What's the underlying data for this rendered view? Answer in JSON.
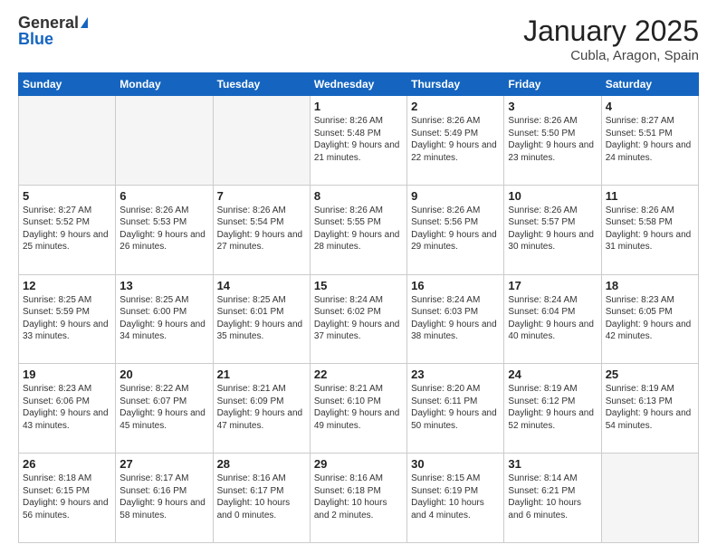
{
  "logo": {
    "general": "General",
    "blue": "Blue"
  },
  "title": "January 2025",
  "subtitle": "Cubla, Aragon, Spain",
  "weekdays": [
    "Sunday",
    "Monday",
    "Tuesday",
    "Wednesday",
    "Thursday",
    "Friday",
    "Saturday"
  ],
  "weeks": [
    [
      {
        "day": "",
        "info": ""
      },
      {
        "day": "",
        "info": ""
      },
      {
        "day": "",
        "info": ""
      },
      {
        "day": "1",
        "info": "Sunrise: 8:26 AM\nSunset: 5:48 PM\nDaylight: 9 hours and 21 minutes."
      },
      {
        "day": "2",
        "info": "Sunrise: 8:26 AM\nSunset: 5:49 PM\nDaylight: 9 hours and 22 minutes."
      },
      {
        "day": "3",
        "info": "Sunrise: 8:26 AM\nSunset: 5:50 PM\nDaylight: 9 hours and 23 minutes."
      },
      {
        "day": "4",
        "info": "Sunrise: 8:27 AM\nSunset: 5:51 PM\nDaylight: 9 hours and 24 minutes."
      }
    ],
    [
      {
        "day": "5",
        "info": "Sunrise: 8:27 AM\nSunset: 5:52 PM\nDaylight: 9 hours and 25 minutes."
      },
      {
        "day": "6",
        "info": "Sunrise: 8:26 AM\nSunset: 5:53 PM\nDaylight: 9 hours and 26 minutes."
      },
      {
        "day": "7",
        "info": "Sunrise: 8:26 AM\nSunset: 5:54 PM\nDaylight: 9 hours and 27 minutes."
      },
      {
        "day": "8",
        "info": "Sunrise: 8:26 AM\nSunset: 5:55 PM\nDaylight: 9 hours and 28 minutes."
      },
      {
        "day": "9",
        "info": "Sunrise: 8:26 AM\nSunset: 5:56 PM\nDaylight: 9 hours and 29 minutes."
      },
      {
        "day": "10",
        "info": "Sunrise: 8:26 AM\nSunset: 5:57 PM\nDaylight: 9 hours and 30 minutes."
      },
      {
        "day": "11",
        "info": "Sunrise: 8:26 AM\nSunset: 5:58 PM\nDaylight: 9 hours and 31 minutes."
      }
    ],
    [
      {
        "day": "12",
        "info": "Sunrise: 8:25 AM\nSunset: 5:59 PM\nDaylight: 9 hours and 33 minutes."
      },
      {
        "day": "13",
        "info": "Sunrise: 8:25 AM\nSunset: 6:00 PM\nDaylight: 9 hours and 34 minutes."
      },
      {
        "day": "14",
        "info": "Sunrise: 8:25 AM\nSunset: 6:01 PM\nDaylight: 9 hours and 35 minutes."
      },
      {
        "day": "15",
        "info": "Sunrise: 8:24 AM\nSunset: 6:02 PM\nDaylight: 9 hours and 37 minutes."
      },
      {
        "day": "16",
        "info": "Sunrise: 8:24 AM\nSunset: 6:03 PM\nDaylight: 9 hours and 38 minutes."
      },
      {
        "day": "17",
        "info": "Sunrise: 8:24 AM\nSunset: 6:04 PM\nDaylight: 9 hours and 40 minutes."
      },
      {
        "day": "18",
        "info": "Sunrise: 8:23 AM\nSunset: 6:05 PM\nDaylight: 9 hours and 42 minutes."
      }
    ],
    [
      {
        "day": "19",
        "info": "Sunrise: 8:23 AM\nSunset: 6:06 PM\nDaylight: 9 hours and 43 minutes."
      },
      {
        "day": "20",
        "info": "Sunrise: 8:22 AM\nSunset: 6:07 PM\nDaylight: 9 hours and 45 minutes."
      },
      {
        "day": "21",
        "info": "Sunrise: 8:21 AM\nSunset: 6:09 PM\nDaylight: 9 hours and 47 minutes."
      },
      {
        "day": "22",
        "info": "Sunrise: 8:21 AM\nSunset: 6:10 PM\nDaylight: 9 hours and 49 minutes."
      },
      {
        "day": "23",
        "info": "Sunrise: 8:20 AM\nSunset: 6:11 PM\nDaylight: 9 hours and 50 minutes."
      },
      {
        "day": "24",
        "info": "Sunrise: 8:19 AM\nSunset: 6:12 PM\nDaylight: 9 hours and 52 minutes."
      },
      {
        "day": "25",
        "info": "Sunrise: 8:19 AM\nSunset: 6:13 PM\nDaylight: 9 hours and 54 minutes."
      }
    ],
    [
      {
        "day": "26",
        "info": "Sunrise: 8:18 AM\nSunset: 6:15 PM\nDaylight: 9 hours and 56 minutes."
      },
      {
        "day": "27",
        "info": "Sunrise: 8:17 AM\nSunset: 6:16 PM\nDaylight: 9 hours and 58 minutes."
      },
      {
        "day": "28",
        "info": "Sunrise: 8:16 AM\nSunset: 6:17 PM\nDaylight: 10 hours and 0 minutes."
      },
      {
        "day": "29",
        "info": "Sunrise: 8:16 AM\nSunset: 6:18 PM\nDaylight: 10 hours and 2 minutes."
      },
      {
        "day": "30",
        "info": "Sunrise: 8:15 AM\nSunset: 6:19 PM\nDaylight: 10 hours and 4 minutes."
      },
      {
        "day": "31",
        "info": "Sunrise: 8:14 AM\nSunset: 6:21 PM\nDaylight: 10 hours and 6 minutes."
      },
      {
        "day": "",
        "info": ""
      }
    ]
  ]
}
